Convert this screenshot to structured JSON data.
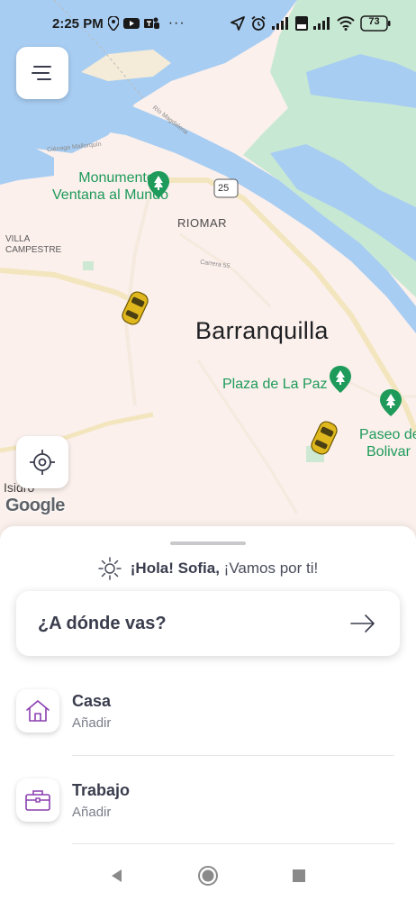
{
  "status_bar": {
    "time": "2:25 PM",
    "battery": "73",
    "icons": [
      "location-pin-icon",
      "youtube-icon",
      "teams-icon",
      "more-dots-icon",
      "navigation-arrow-icon",
      "alarm-icon",
      "signal-icon",
      "volte-icon",
      "wifi-icon",
      "battery-icon"
    ]
  },
  "map": {
    "city": "Barranquilla",
    "area_riomar": "RIOMAR",
    "area_villa_line1": "VILLA",
    "area_villa_line2": "CAMPESTRE",
    "poi_monumento_line1": "Monumento",
    "poi_monumento_line2": "Ventana al Mundo",
    "poi_plaza": "Plaza de La Paz",
    "poi_paseo_line1": "Paseo de",
    "poi_paseo_line2": "Bolivar",
    "route_25": "25",
    "small_cienaga": "Ciénaga Mallorquín",
    "small_rio": "Río Magdalena",
    "small_carrera55": "Carrera 55",
    "small_isidro": "Isidro",
    "google": "Google",
    "colors": {
      "water": "#a8cdf2",
      "land": "#fbf0ec",
      "green": "#bfe6cf",
      "road": "#f3e6be",
      "poi_green": "#1e9a5a"
    }
  },
  "sheet": {
    "greeting_prefix": "¡Hola! Sofia,",
    "greeting_suffix": "¡Vamos por ti!",
    "destination_prompt": "¿A dónde vas?",
    "places": [
      {
        "title": "Casa",
        "subtitle": "Añadir",
        "icon": "home-icon"
      },
      {
        "title": "Trabajo",
        "subtitle": "Añadir",
        "icon": "briefcase-icon"
      }
    ],
    "accent_color": "#8a3fb0"
  },
  "nav_bar": {
    "icons": [
      "back-triangle-icon",
      "home-circle-icon",
      "recents-square-icon"
    ]
  }
}
